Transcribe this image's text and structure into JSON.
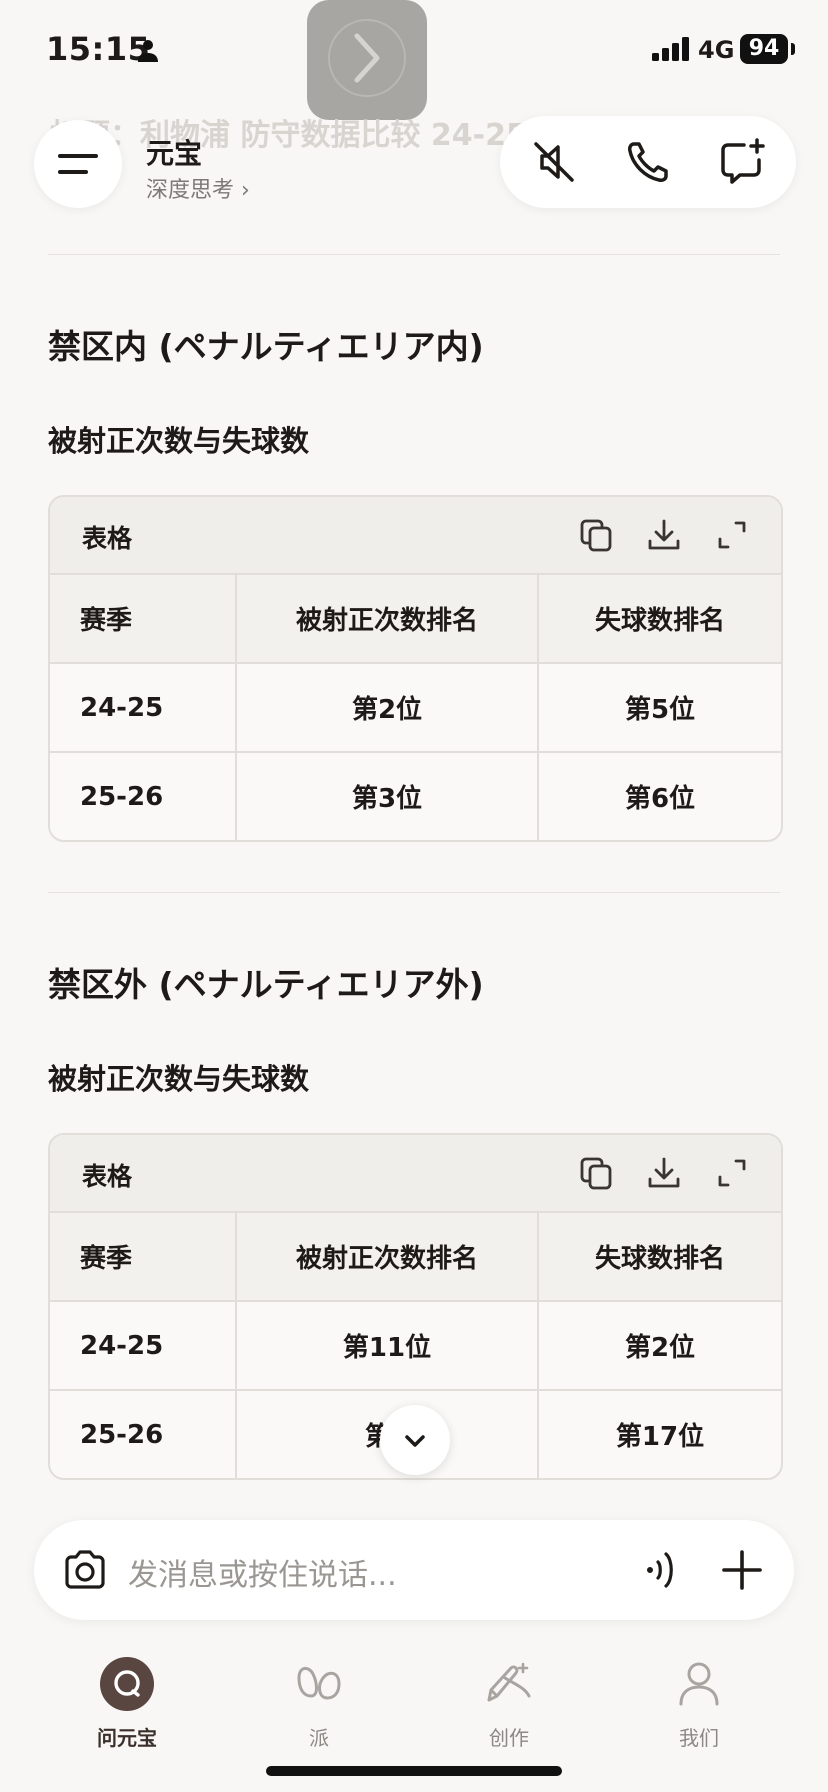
{
  "status": {
    "time": "15:15",
    "network": "4G",
    "battery": "94"
  },
  "header": {
    "faded_title": "标题：利物浦 防守数据比较 24-25 与 25-26",
    "app_name": "元宝",
    "mode": "深度思考 ›"
  },
  "sections": [
    {
      "heading": "禁区内 (ペナルティエリア内)",
      "subheading": "被射正次数与失球数",
      "table": {
        "toolbar_label": "表格",
        "headers": [
          "赛季",
          "被射正次数排名",
          "失球数排名"
        ],
        "rows": [
          [
            "24-25",
            "第2位",
            "第5位"
          ],
          [
            "25-26",
            "第3位",
            "第6位"
          ]
        ]
      }
    },
    {
      "heading": "禁区外 (ペナルティエリア外)",
      "subheading": "被射正次数与失球数",
      "table": {
        "toolbar_label": "表格",
        "headers": [
          "赛季",
          "被射正次数排名",
          "失球数排名"
        ],
        "rows": [
          [
            "24-25",
            "第11位",
            "第2位"
          ],
          [
            "25-26",
            "第1",
            "第17位"
          ]
        ]
      }
    }
  ],
  "input": {
    "placeholder": "发消息或按住说话..."
  },
  "nav": [
    {
      "label": "问元宝",
      "icon": "chat-bubble-icon",
      "active": true
    },
    {
      "label": "派",
      "icon": "infinity-icon",
      "active": false
    },
    {
      "label": "创作",
      "icon": "pen-sparkle-icon",
      "active": false
    },
    {
      "label": "我们",
      "icon": "person-icon",
      "active": false
    }
  ],
  "colors": {
    "background": "#f8f7f5",
    "text": "#1e1a17",
    "active_nav": "#5a4640",
    "muted": "#8c8884"
  }
}
